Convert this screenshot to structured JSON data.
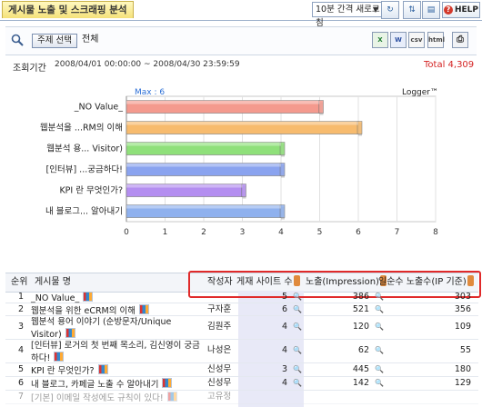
{
  "header": {
    "title": "게시물 노출 및 스크래핑 분석",
    "refresh_select": "10분 간격 새로고침",
    "help_label": "HELP",
    "icon_labels": [
      "csv",
      "html"
    ]
  },
  "subject": {
    "button_label": "주제 선택",
    "value": "전체"
  },
  "period": {
    "label": "조회기간",
    "value": "2008/04/01 00:00:00 ~ 2008/04/30 23:59:59",
    "total": "Total 4,309"
  },
  "chart_data": {
    "type": "bar",
    "orientation": "horizontal",
    "max_label": "Max : 6",
    "brand": "Logger™",
    "categories": [
      "_NO Value_",
      "웹분석을 ...RM의 이해",
      "웹분석 용... Visitor)",
      "[인터뷰] ...궁금하다!",
      "KPI 란 무엇인가?",
      "내 블로그... 알아내기"
    ],
    "values": [
      5,
      6,
      4,
      4,
      3,
      4
    ],
    "colors": [
      "#f49a8e",
      "#f7bb6e",
      "#8fe07a",
      "#8aa3ef",
      "#b48ef0",
      "#8fb1ee"
    ],
    "xlim": [
      0,
      8
    ],
    "xticks": [
      "0",
      "1",
      "2",
      "3",
      "4",
      "5",
      "6",
      "7",
      "8"
    ],
    "grid": true
  },
  "table": {
    "columns": {
      "rank": "순위",
      "post": "게시물 명",
      "author": "작성자",
      "sites": "게재 사이트 수",
      "impression": "노출(Impression)",
      "daily": "일순수 노출수(IP 기준)"
    },
    "rows": [
      {
        "rank": "1",
        "post": "_NO Value_",
        "author": "",
        "sites": "5",
        "impression": "386",
        "daily": "303"
      },
      {
        "rank": "2",
        "post": "웹분석을 위한 eCRM의 이해",
        "author": "구자훈",
        "sites": "6",
        "impression": "521",
        "daily": "356"
      },
      {
        "rank": "3",
        "post": "웹분석 용어 이야기 (순방문자/Unique Visitor)",
        "author": "김원주",
        "sites": "4",
        "impression": "120",
        "daily": "109"
      },
      {
        "rank": "4",
        "post": "[인터뷰] 로거의 첫 번째 목소리, 김신영이 궁금하다!",
        "author": "나성은",
        "sites": "4",
        "impression": "62",
        "daily": "55"
      },
      {
        "rank": "5",
        "post": "KPI 란 무엇인가?",
        "author": "신성무",
        "sites": "3",
        "impression": "445",
        "daily": "180"
      },
      {
        "rank": "6",
        "post": "내 블로그, 카페글 노출 수 알아내기",
        "author": "신성무",
        "sites": "4",
        "impression": "142",
        "daily": "129"
      },
      {
        "rank": "7",
        "post": "[기본] 이메일 작성에도 규칙이 있다!",
        "author": "고유정",
        "sites": "",
        "impression": "",
        "daily": ""
      }
    ]
  }
}
